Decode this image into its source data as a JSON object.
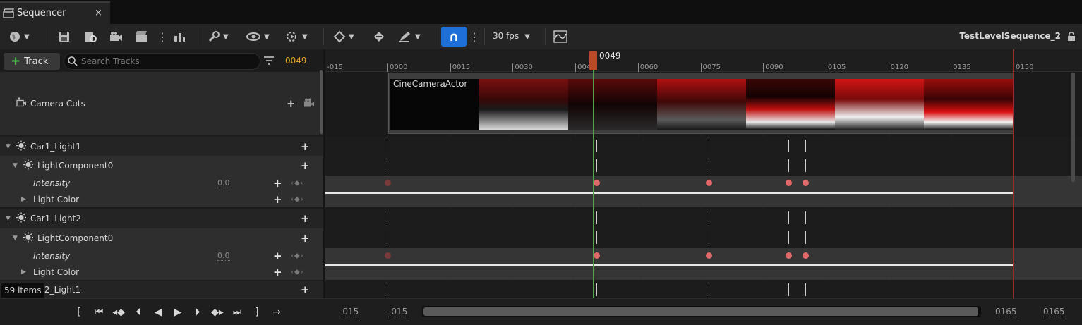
{
  "tab": {
    "title": "Sequencer",
    "close": "×"
  },
  "toolbar": {
    "fps": "30 fps",
    "sequence_name": "TestLevelSequence_2"
  },
  "left": {
    "track_button": "Track",
    "search_placeholder": "Search Tracks",
    "current_frame": "0049",
    "items_count": "59 items",
    "rows": [
      {
        "label": "Camera Cuts"
      },
      {
        "label": "Car1_Light1"
      },
      {
        "label": "LightComponent0"
      },
      {
        "label": "Intensity",
        "value": "0.0"
      },
      {
        "label": "Light Color"
      },
      {
        "label": "Car1_Light2"
      },
      {
        "label": "LightComponent0"
      },
      {
        "label": "Intensity",
        "value": "0.0"
      },
      {
        "label": "Light Color"
      },
      {
        "label": "r2_Light1"
      }
    ]
  },
  "timeline": {
    "playhead": "0049",
    "ticks": [
      "-015",
      "0000",
      "0015",
      "0030",
      "0045",
      "0060",
      "0075",
      "0090",
      "0105",
      "0120",
      "0135",
      "0150"
    ],
    "camera_label": "CineCameraActor"
  },
  "bottom": {
    "range_start_outer": "-015",
    "range_start": "-015",
    "range_end": "0165",
    "range_end_outer": "0165"
  }
}
